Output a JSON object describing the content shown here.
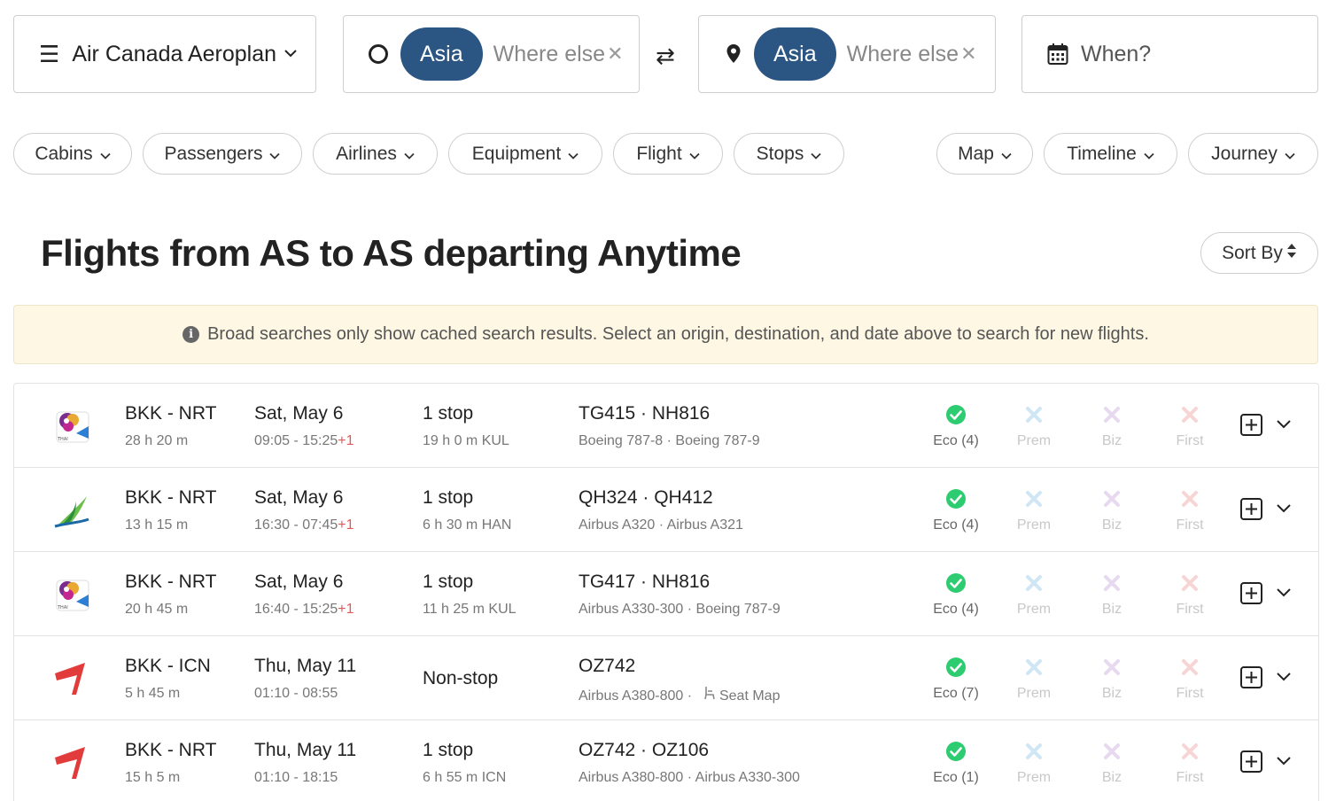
{
  "search": {
    "program": "Air Canada Aeroplan",
    "origin_pill": "Asia",
    "origin_placeholder": "Where else",
    "destination_pill": "Asia",
    "destination_placeholder": "Where else",
    "when_placeholder": "When?"
  },
  "filters": [
    "Cabins",
    "Passengers",
    "Airlines",
    "Equipment",
    "Flight",
    "Stops"
  ],
  "view_filters": [
    "Map",
    "Timeline",
    "Journey"
  ],
  "title": {
    "prefix": "Flights from ",
    "origin": "AS",
    "to": " to ",
    "destination": "AS",
    "departing": " departing ",
    "when": "Anytime"
  },
  "sort_label": "Sort By",
  "notice": "Broad searches only show cached search results. Select an origin, destination, and date above to search for new flights.",
  "cabin_labels": {
    "prem": "Prem",
    "biz": "Biz",
    "first": "First"
  },
  "rows": [
    {
      "airline_icon": "thai-airways-logo",
      "route": "BKK - NRT",
      "duration": "28 h 20 m",
      "date": "Sat, May 6",
      "times": "09:05 - 15:25",
      "plus_day": "+1",
      "stops": "1 stop",
      "layover": "19 h 0 m  KUL",
      "flights": "TG415  ·  NH816",
      "equipment": "Boeing 787-8  ·  Boeing 787-9",
      "eco": "Eco (4)"
    },
    {
      "airline_icon": "bamboo-airways-logo",
      "route": "BKK - NRT",
      "duration": "13 h 15 m",
      "date": "Sat, May 6",
      "times": "16:30 - 07:45",
      "plus_day": "+1",
      "stops": "1 stop",
      "layover": "6 h 30 m  HAN",
      "flights": "QH324  ·  QH412",
      "equipment": "Airbus A320  ·  Airbus A321",
      "eco": "Eco (4)"
    },
    {
      "airline_icon": "thai-airways-logo",
      "route": "BKK - NRT",
      "duration": "20 h 45 m",
      "date": "Sat, May 6",
      "times": "16:40 - 15:25",
      "plus_day": "+1",
      "stops": "1 stop",
      "layover": "11 h 25 m  KUL",
      "flights": "TG417  ·  NH816",
      "equipment": "Airbus A330-300  ·  Boeing 787-9",
      "eco": "Eco (4)"
    },
    {
      "airline_icon": "asiana-logo",
      "route": "BKK - ICN",
      "duration": "5 h 45 m",
      "date": "Thu, May 11",
      "times": "01:10 - 08:55",
      "plus_day": "",
      "stops": "Non-stop",
      "layover": "",
      "flights": "OZ742",
      "equipment": "Airbus A380-800  ·",
      "seat_map": "Seat Map",
      "eco": "Eco (7)"
    },
    {
      "airline_icon": "asiana-logo",
      "route": "BKK - NRT",
      "duration": "15 h 5 m",
      "date": "Thu, May 11",
      "times": "01:10 - 18:15",
      "plus_day": "",
      "stops": "1 stop",
      "layover": "6 h 55 m  ICN",
      "flights": "OZ742  ·  OZ106",
      "equipment": "Airbus A380-800  ·  Airbus A330-300",
      "eco": "Eco (1)"
    }
  ],
  "colors": {
    "pill": "#2b5582",
    "available": "#2ecc71",
    "prem_unavailable": "#cfe6f5",
    "biz_unavailable": "#e7d9ef",
    "first_unavailable": "#f8d5d5",
    "notice_bg": "#fdf7e3"
  }
}
